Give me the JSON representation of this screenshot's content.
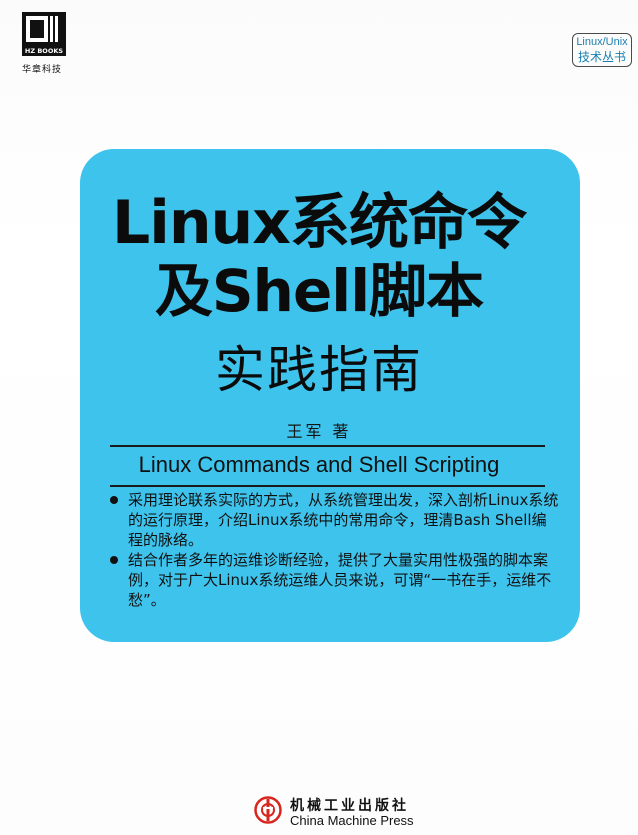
{
  "publisher_logo": {
    "mark_text": "HZ BOOKS",
    "brand": "华章科技",
    "icon": "hz-books-logo-icon"
  },
  "series_badge": {
    "line1": "Linux/Unix",
    "line2": "技术丛书"
  },
  "title": {
    "line1": "Linux系统命令",
    "line2": "及Shell脚本",
    "line3": "实践指南"
  },
  "author": "王军  著",
  "subtitle_en": "Linux Commands and Shell Scripting",
  "bullets": [
    "采用理论联系实际的方式，从系统管理出发，深入剖析Linux系统的运行原理，介绍Linux系统中的常用命令，理清Bash Shell编程的脉络。",
    "结合作者多年的运维诊断经验，提供了大量实用性极强的脚本案例，对于广大Linux系统运维人员来说，可谓“一书在手，运维不愁”。"
  ],
  "press": {
    "name_cn": "机械工业出版社",
    "name_en": "China Machine Press",
    "icon": "china-machine-press-logo-icon"
  },
  "colors": {
    "panel": "#3ec3ec",
    "badge_text": "#1a7fb0",
    "press_red": "#d7261e"
  }
}
